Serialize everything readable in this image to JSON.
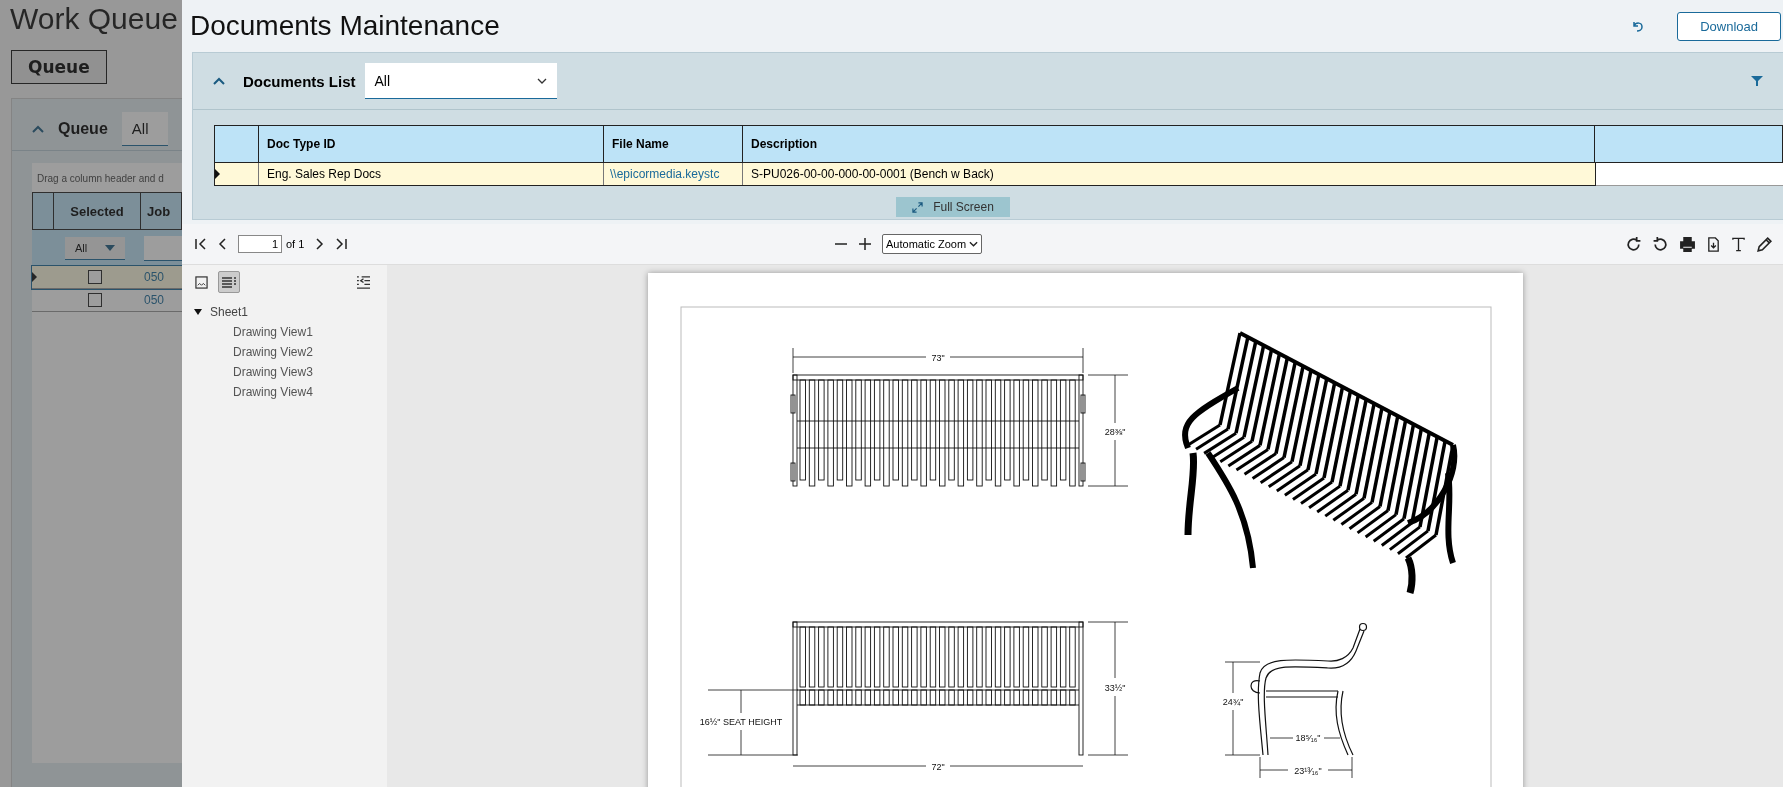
{
  "background_screen": {
    "title": "Work Queue",
    "queue_button": "Queue",
    "panel": {
      "title": "Queue",
      "filter": "All",
      "expanded": true
    },
    "group_hint": "Drag a column header and d",
    "grid": {
      "columns": [
        "Selected",
        "Job"
      ],
      "filter_value": "All",
      "rows": [
        {
          "selected": true,
          "checked": false,
          "job": "050"
        },
        {
          "selected": false,
          "checked": false,
          "job": "050"
        }
      ]
    }
  },
  "dialog": {
    "title": "Documents Maintenance",
    "download_button": "Download"
  },
  "documents_list": {
    "title": "Documents List",
    "filter": "All",
    "expanded": true,
    "columns": [
      "Doc Type ID",
      "File Name",
      "Description"
    ],
    "rows": [
      {
        "selected": true,
        "doc_type_id": "Eng. Sales Rep Docs",
        "file_name": "\\\\epicormedia.keystc",
        "description": "S-PU026-00-00-000-00-0001 (Bench w Back)"
      }
    ],
    "full_screen_button": "Full Screen"
  },
  "viewer": {
    "page_input": "1",
    "page_count": "of 1",
    "zoom": "Automatic Zoom",
    "sidebar_modes": [
      {
        "kind": "thumbnails",
        "selected": false
      },
      {
        "kind": "outline",
        "selected": true
      }
    ],
    "outline": [
      {
        "label": "Sheet1",
        "expanded": true,
        "children": [
          {
            "label": "Drawing View1"
          },
          {
            "label": "Drawing View2"
          },
          {
            "label": "Drawing View3"
          },
          {
            "label": "Drawing View4"
          }
        ]
      }
    ]
  },
  "drawing": {
    "dimension_labels": [
      "73\"",
      "28⅜\"",
      "16½\" SEAT HEIGHT",
      "72\"",
      "33½\"",
      "24¾\"",
      "18⁵⁄₁₆\"",
      "23¹³⁄₁₆\""
    ]
  }
}
